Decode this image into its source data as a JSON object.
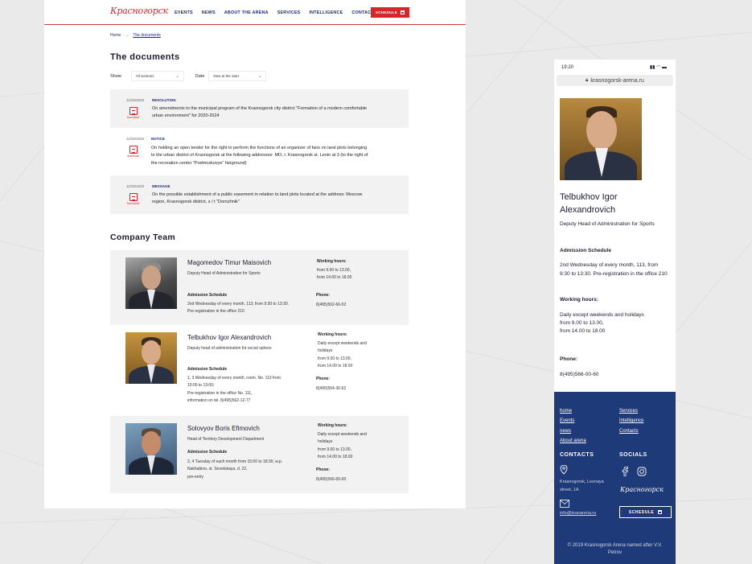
{
  "desktop": {
    "logo": "Красногорск",
    "nav": [
      "EVENTS",
      "NEWS",
      "ABOUT THE ARENA",
      "SERVICES",
      "INTELLIGENCE",
      "CONTACTS"
    ],
    "schedule_button": "SCHEDULE",
    "breadcrumb": {
      "home": "Home",
      "separator": "→",
      "current": "The documents"
    },
    "title": "The documents",
    "filters": {
      "show_label": "Show",
      "show_value": "All sections",
      "date_label": "Date",
      "date_value": "New at the start"
    },
    "documents": [
      {
        "date": "11/26/2020",
        "type": "RESOLUTION",
        "download": "Download",
        "text": [
          "On amendments to the municipal program of the Krasnogorsk city district \"Formation of a modern comfortable",
          "urban environment\" for 2020-2024"
        ]
      },
      {
        "date": "11/26/2020",
        "type": "NOTICE",
        "download": "download",
        "text": [
          "On holding an open tender for the right to perform the functions of an organizer of fairs on land plots belonging",
          "to the urban district of Krasnogorsk at the following addresses: MO, r. Krasnogorsk st. Lenin at 3 (to the right of",
          "the recreation center \"Podmoskovye\" fairground)"
        ]
      },
      {
        "date": "11/25/2020",
        "type": "MESSAGE",
        "download": "Download",
        "text": [
          "On the possible establishment of a public easement in relation to land plots located at the address: Moscow",
          "region, Krasnogorsk district, s / t \"Dorozhnik\""
        ]
      }
    ],
    "team_title": "Company Team",
    "team": [
      {
        "name": "Magomedov Timur Maisovich",
        "role": "Deputy Head of Administration for Sports",
        "schedule_label": "Admission Schedule",
        "schedule": [
          "2nd Wednesday of every month, 113, from 9:30 to 13:30.",
          "Pre-registration in the office 210"
        ],
        "hours_label": "Working hours:",
        "hours": [
          "from 9.00 to 13.00,",
          "from 14.00 to 18.00"
        ],
        "phone_label": "Phone:",
        "phone": "8(495)562-66-52"
      },
      {
        "name": "Telbukhov Igor Alexandrovich",
        "role": "Deputy head of administration for social sphere",
        "schedule_label": "Admission Schedule",
        "schedule": [
          "1, 3 Wednesday of every month, room. No. 113 from",
          "10:00 to 13:00;",
          "Pre-registration in the office No. 111,",
          "information on tel. 8(495)562-12-77"
        ],
        "hours_label": "Working hours:",
        "hours": [
          "Daily except weekends and",
          "holidays",
          "from 9.00 to 13.00,",
          "from 14.00 to 18.00"
        ],
        "phone_label": "Phone:",
        "phone": "8(495)564-30-62"
      },
      {
        "name": "Solovyov Boris Efimovich",
        "role": "Head of Territory Development Department",
        "schedule_label": "Admission Schedule",
        "schedule": [
          "2, 4 Tuesday of each month from 15:00 to 18:30, w.p.",
          "Nakhabino, st. Sovetskaya, d. 22,",
          "pre-entry"
        ],
        "hours_label": "Working hours:",
        "hours": [
          "Daily except weekends and",
          "holidays",
          "from 9.00 to 13.00,",
          "from 14.00 to 18.00"
        ],
        "phone_label": "Phone:",
        "phone": "8(495)566-00-60"
      }
    ]
  },
  "mobile": {
    "time": "19:20",
    "url": "krasnogorsk-arena.ru",
    "name_line1": "Telbukhov Igor",
    "name_line2": "Alexandrovich",
    "role": "Deputy Head of Administration for Sports",
    "schedule_label": "Admission Schedule",
    "schedule": [
      "2nd Wednesday of every month, 113, from",
      "9:30 to 13:30. Pre-registration in the office 210"
    ],
    "hours_label": "Working hours:",
    "hours": [
      "Daily except weekends and holidays",
      "from 9.00 to 13.00,",
      "from 14.00 to 18.00"
    ],
    "phone_label": "Phone:",
    "phone": "8(495)566-00-60",
    "footer": {
      "links_left": [
        "home",
        "Events",
        "news",
        "About arena"
      ],
      "links_right": [
        "Services",
        "Intelligence",
        "Contacts"
      ],
      "contacts_title": "CONTACTS",
      "socials_title": "SOCIALS",
      "address": [
        "Krasnogorsk, Lesnaya",
        "street, 1A"
      ],
      "email": "info@krasarena.ru",
      "logo": "Красногорск",
      "schedule_button": "SCHEDULE",
      "copyright": "© 2019 Krasnogorsk Arena named after V.V. Petrov"
    }
  }
}
